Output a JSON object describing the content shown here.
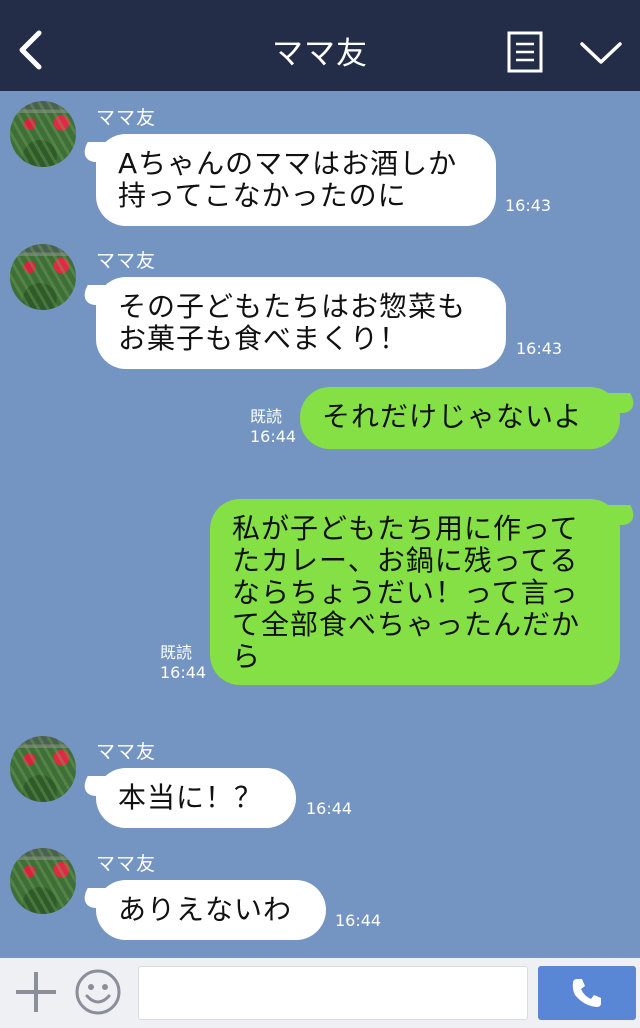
{
  "header": {
    "title": "ママ友",
    "back_icon": "chevron-left-icon",
    "menu_icon": "menu-lines-icon",
    "collapse_icon": "chevron-down-icon"
  },
  "messages": [
    {
      "side": "left",
      "sender": "ママ友",
      "lines": [
        "Aちゃんのママはお酒しか",
        "持ってこなかったのに"
      ],
      "time": "16:43"
    },
    {
      "side": "left",
      "sender": "ママ友",
      "lines": [
        "その子どもたちはお惣菜も",
        "お菓子も食べまくり！"
      ],
      "time": "16:43"
    },
    {
      "side": "right",
      "read": "既読",
      "lines": [
        "それだけじゃないよ"
      ],
      "time": "16:44"
    },
    {
      "side": "right",
      "read": "既読",
      "lines": [
        "私が子どもたち用に作って",
        "たカレー、お鍋に残ってる",
        "ならちょうだい！って言っ",
        "て全部食べちゃったんだか",
        "ら"
      ],
      "time": "16:44"
    },
    {
      "side": "left",
      "sender": "ママ友",
      "lines": [
        "本当に！？"
      ],
      "time": "16:44"
    },
    {
      "side": "left",
      "sender": "ママ友",
      "lines": [
        "ありえないわ"
      ],
      "time": "16:44"
    }
  ],
  "footer": {
    "input_value": "",
    "add_icon": "plus-icon",
    "emoji_icon": "smiley-icon",
    "call_icon": "phone-icon"
  },
  "colors": {
    "header_bg": "#232d48",
    "chat_bg": "#7494c2",
    "sent_bubble": "#84e044",
    "received_bubble": "#ffffff",
    "call_button": "#5a86d6"
  }
}
